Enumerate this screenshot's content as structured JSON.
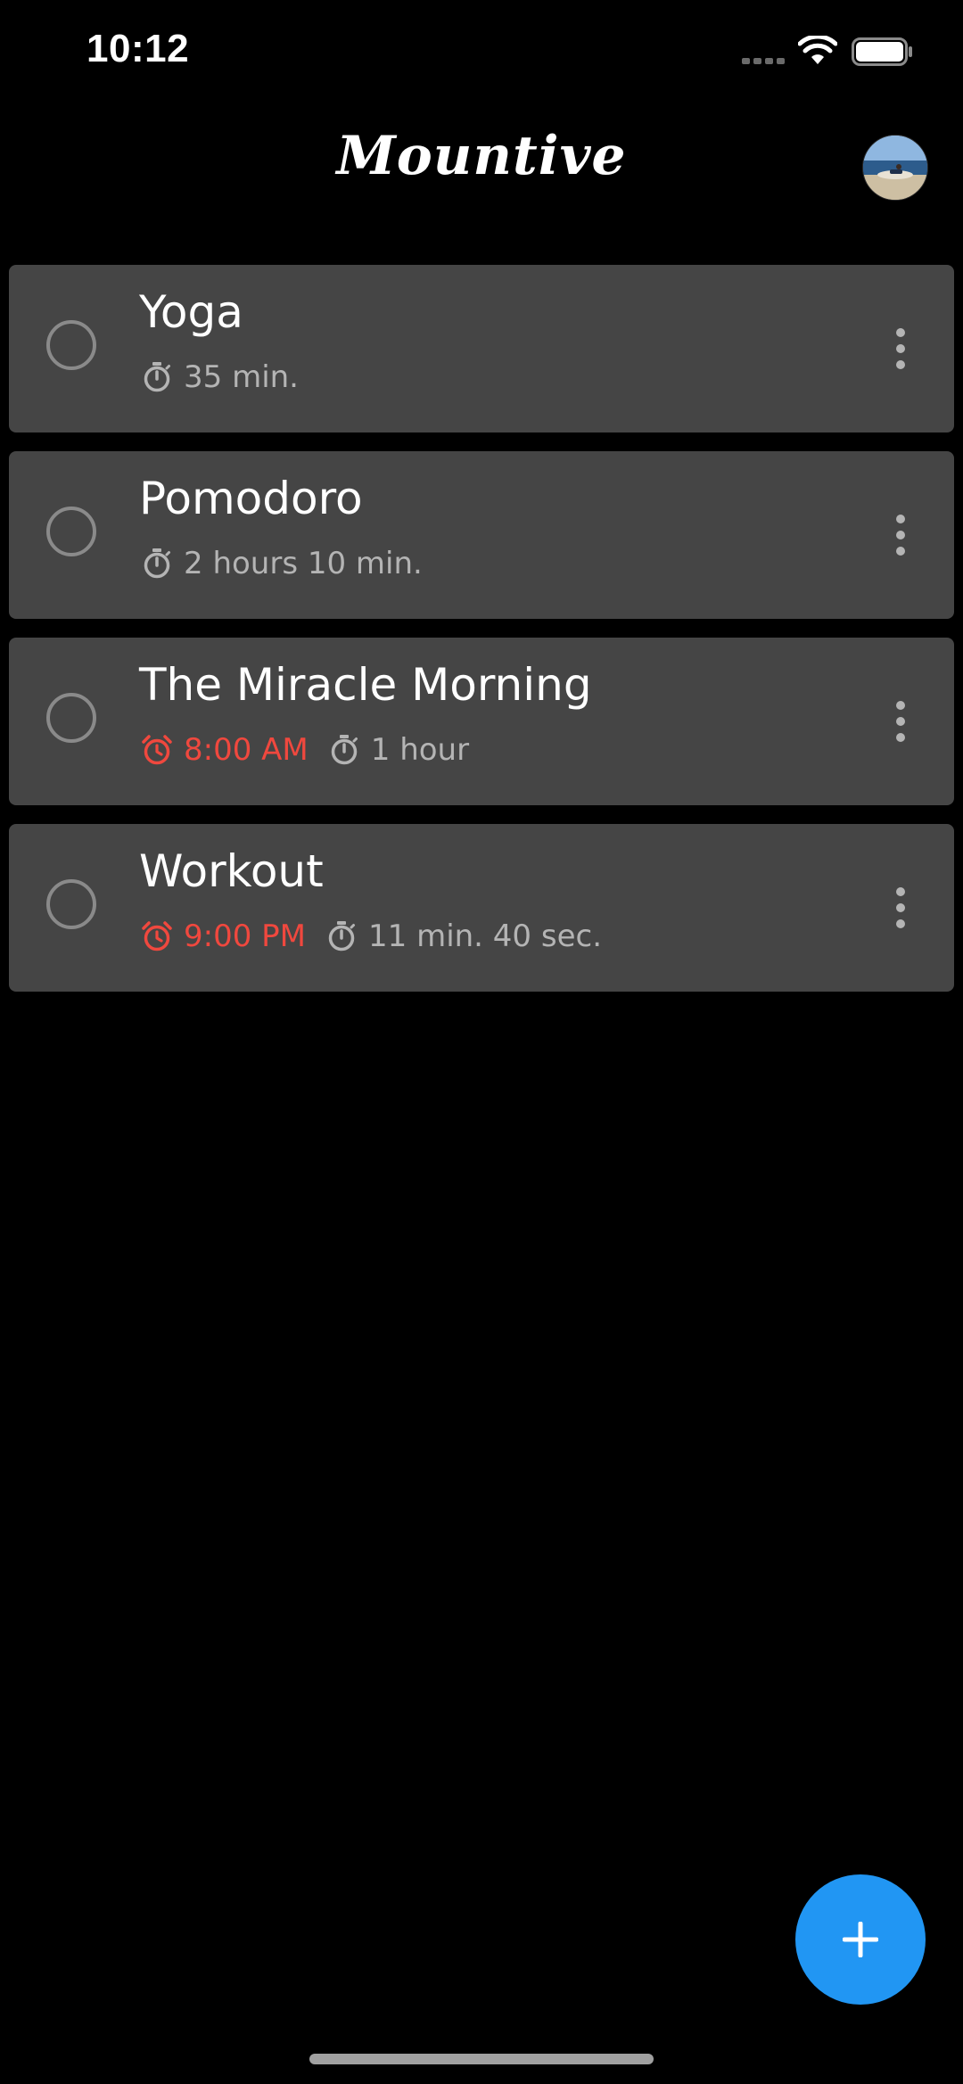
{
  "status_bar": {
    "time": "10:12"
  },
  "header": {
    "title": "Mountive"
  },
  "colors": {
    "background": "#000000",
    "card": "#454545",
    "alarm": "#f0483e",
    "meta_text": "#b4b4b4",
    "fab": "#2196f3"
  },
  "tasks": [
    {
      "title": "Yoga",
      "alarm_time": null,
      "duration": "35 min."
    },
    {
      "title": "Pomodoro",
      "alarm_time": null,
      "duration": "2 hours 10 min."
    },
    {
      "title": "The Miracle Morning",
      "alarm_time": "8:00 AM",
      "duration": "1 hour"
    },
    {
      "title": "Workout",
      "alarm_time": "9:00 PM",
      "duration": "11 min. 40 sec."
    }
  ],
  "icons": {
    "signal": "signal-dots-icon",
    "wifi": "wifi-icon",
    "battery": "battery-icon",
    "check": "circle-checkbox-icon",
    "alarm": "alarm-clock-icon",
    "timer": "stopwatch-icon",
    "menu": "more-vertical-icon",
    "add": "plus-icon"
  }
}
